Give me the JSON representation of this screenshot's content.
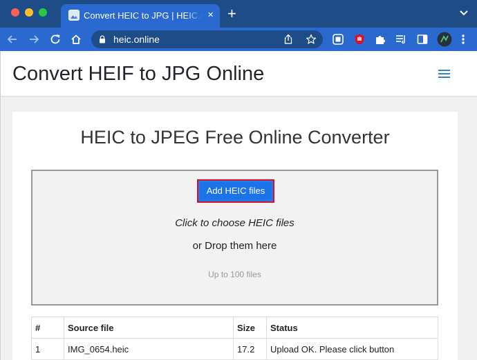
{
  "browser": {
    "tab_title": "Convert HEIC to JPG | HEIC.online",
    "tab_close": "×",
    "new_tab": "+",
    "url": "heic.online"
  },
  "site": {
    "title": "Convert HEIF to JPG Online",
    "menu_icon": "hamburger-icon"
  },
  "converter": {
    "heading": "HEIC to JPEG Free Online Converter",
    "add_button": "Add HEIC files",
    "choose_text": "Click to choose HEIC files",
    "drop_text": "or Drop them here",
    "limit_text": "Up to 100 files"
  },
  "table": {
    "headers": [
      "#",
      "Source file",
      "Size",
      "Status"
    ],
    "rows": [
      [
        "1",
        "IMG_0654.heic",
        "17.2",
        "Upload OK. Please click button"
      ]
    ]
  },
  "colors": {
    "tab_strip": "#1d4c86",
    "toolbar": "#2a6ad0",
    "button": "#1a73e8",
    "highlight": "#d4102a"
  }
}
